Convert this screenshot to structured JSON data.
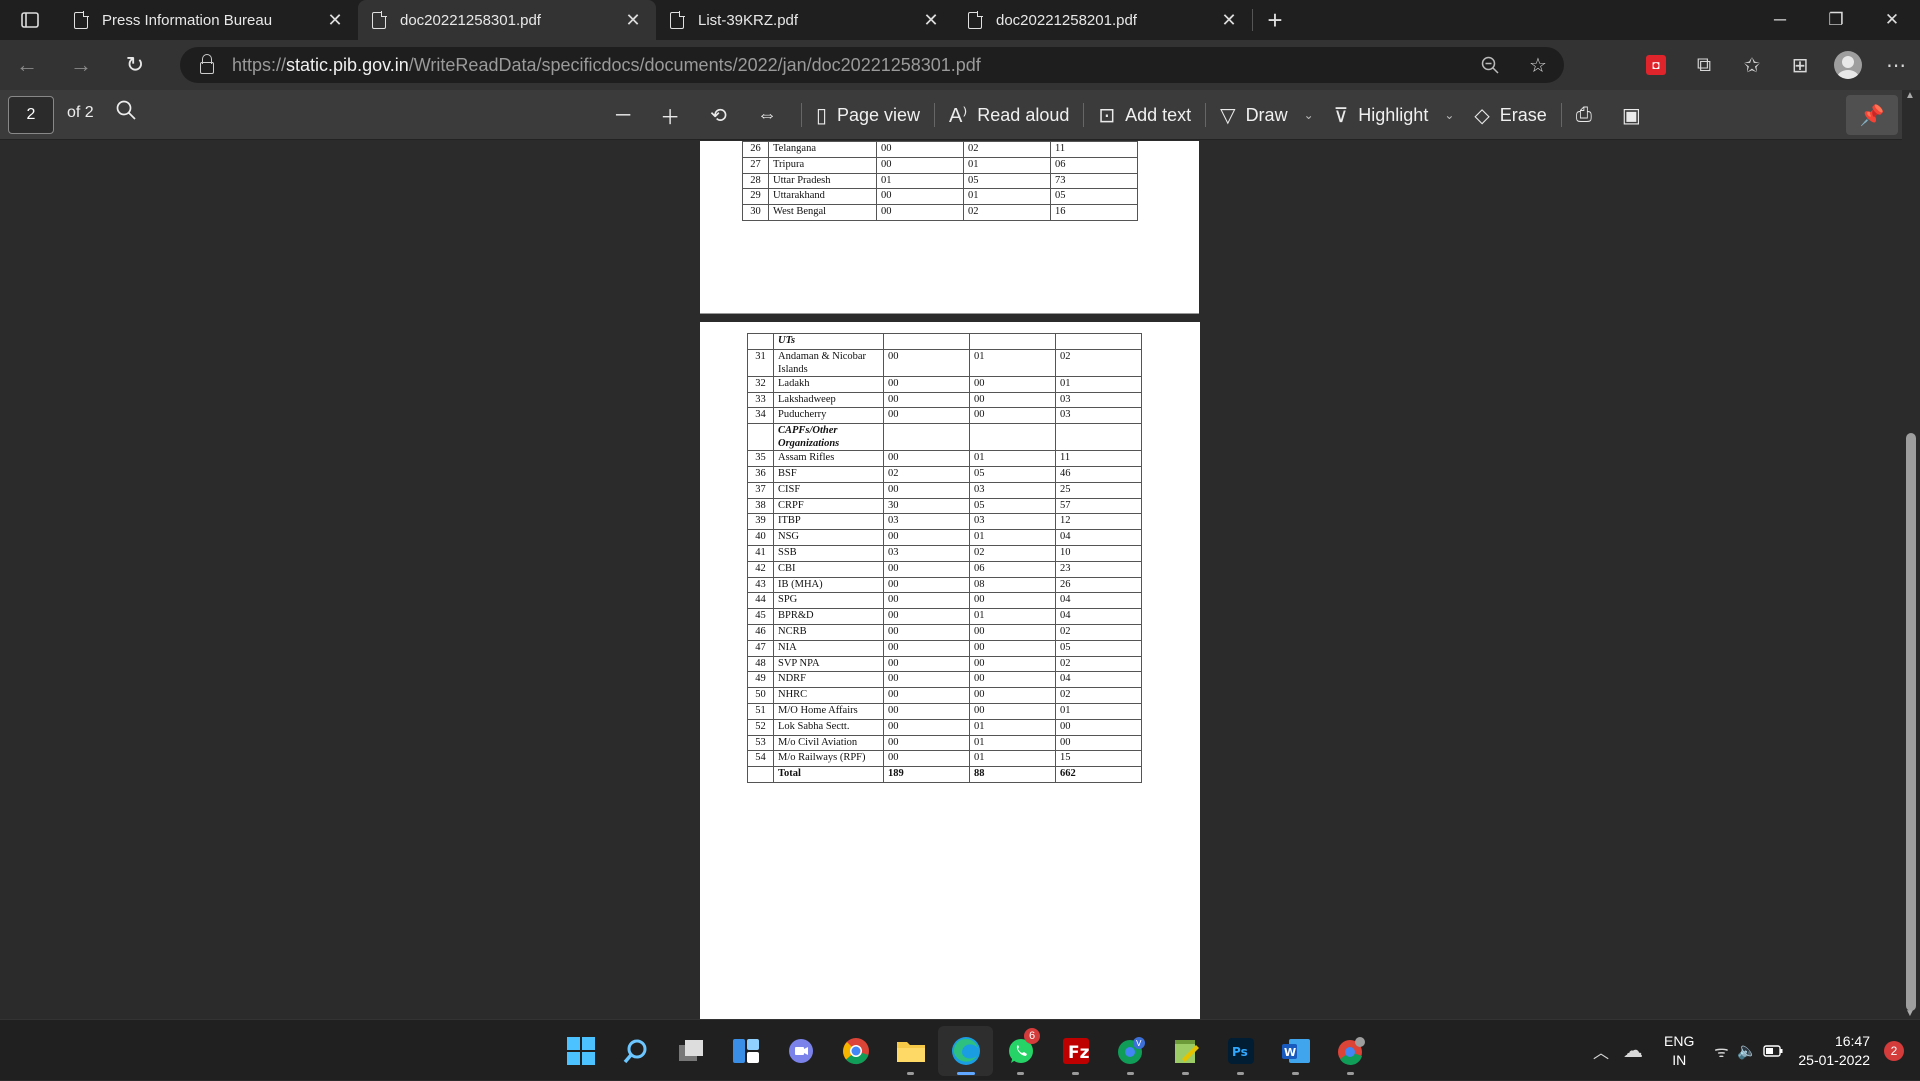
{
  "browser": {
    "tabs": [
      {
        "title": "Press Information Bureau",
        "active": false
      },
      {
        "title": "doc20221258301.pdf",
        "active": true
      },
      {
        "title": "List-39KRZ.pdf",
        "active": false
      },
      {
        "title": "doc20221258201.pdf",
        "active": false
      }
    ],
    "url_prefix": "https://",
    "url_host": "static.pib.gov.in",
    "url_path": "/WriteReadData/specificdocs/documents/2022/jan/doc20221258301.pdf"
  },
  "pdf_toolbar": {
    "current_page": "2",
    "page_count": "of 2",
    "page_view": "Page view",
    "read_aloud": "Read aloud",
    "add_text": "Add text",
    "draw": "Draw",
    "highlight": "Highlight",
    "erase": "Erase"
  },
  "page1_rows": [
    {
      "n": "26",
      "name": "Telangana",
      "a": "00",
      "b": "02",
      "c": "11"
    },
    {
      "n": "27",
      "name": "Tripura",
      "a": "00",
      "b": "01",
      "c": "06"
    },
    {
      "n": "28",
      "name": "Uttar Pradesh",
      "a": "01",
      "b": "05",
      "c": "73"
    },
    {
      "n": "29",
      "name": "Uttarakhand",
      "a": "00",
      "b": "01",
      "c": "05"
    },
    {
      "n": "30",
      "name": "West Bengal",
      "a": "00",
      "b": "02",
      "c": "16"
    }
  ],
  "page2_rows": [
    {
      "n": "",
      "name": "UTs",
      "a": "",
      "b": "",
      "c": "",
      "header": true
    },
    {
      "n": "31",
      "name": "Andaman & Nicobar",
      "name2": "Islands",
      "a": "00",
      "b": "01",
      "c": "02"
    },
    {
      "n": "32",
      "name": "Ladakh",
      "a": "00",
      "b": "00",
      "c": "01"
    },
    {
      "n": "33",
      "name": "Lakshadweep",
      "a": "00",
      "b": "00",
      "c": "03"
    },
    {
      "n": "34",
      "name": "Puducherry",
      "a": "00",
      "b": "00",
      "c": "03"
    },
    {
      "n": "",
      "name": "CAPFs/Other",
      "name2": "Organizations",
      "a": "",
      "b": "",
      "c": "",
      "header": true
    },
    {
      "n": "35",
      "name": "Assam Rifles",
      "a": "00",
      "b": "01",
      "c": "11"
    },
    {
      "n": "36",
      "name": "BSF",
      "a": "02",
      "b": "05",
      "c": "46"
    },
    {
      "n": "37",
      "name": "CISF",
      "a": "00",
      "b": "03",
      "c": "25"
    },
    {
      "n": "38",
      "name": "CRPF",
      "a": "30",
      "b": "05",
      "c": "57"
    },
    {
      "n": "39",
      "name": "ITBP",
      "a": "03",
      "b": "03",
      "c": "12"
    },
    {
      "n": "40",
      "name": "NSG",
      "a": "00",
      "b": "01",
      "c": "04"
    },
    {
      "n": "41",
      "name": "SSB",
      "a": "03",
      "b": "02",
      "c": "10"
    },
    {
      "n": "42",
      "name": "CBI",
      "a": "00",
      "b": "06",
      "c": "23"
    },
    {
      "n": "43",
      "name": "IB (MHA)",
      "a": "00",
      "b": "08",
      "c": "26"
    },
    {
      "n": "44",
      "name": "SPG",
      "a": "00",
      "b": "00",
      "c": "04"
    },
    {
      "n": "45",
      "name": "BPR&D",
      "a": "00",
      "b": "01",
      "c": "04"
    },
    {
      "n": "46",
      "name": "NCRB",
      "a": "00",
      "b": "00",
      "c": "02"
    },
    {
      "n": "47",
      "name": "NIA",
      "a": "00",
      "b": "00",
      "c": "05"
    },
    {
      "n": "48",
      "name": "SVP NPA",
      "a": "00",
      "b": "00",
      "c": "02"
    },
    {
      "n": "49",
      "name": "NDRF",
      "a": "00",
      "b": "00",
      "c": "04"
    },
    {
      "n": "50",
      "name": "NHRC",
      "a": "00",
      "b": "00",
      "c": "02"
    },
    {
      "n": "51",
      "name": "M/O Home Affairs",
      "a": "00",
      "b": "00",
      "c": "01"
    },
    {
      "n": "52",
      "name": "Lok Sabha Sectt.",
      "a": "00",
      "b": "01",
      "c": "00"
    },
    {
      "n": "53",
      "name": "M/o Civil Aviation",
      "a": "00",
      "b": "01",
      "c": "00"
    },
    {
      "n": "54",
      "name": "M/o Railways (RPF)",
      "a": "00",
      "b": "01",
      "c": "15"
    },
    {
      "n": "",
      "name": "Total",
      "a": "189",
      "b": "88",
      "c": "662",
      "total": true
    }
  ],
  "taskbar": {
    "apps": [
      "start",
      "search",
      "task-view",
      "widgets",
      "teams-chat",
      "chrome",
      "file-explorer",
      "edge",
      "whatsapp",
      "filezilla",
      "chrome-profile",
      "notepad-plus",
      "photoshop",
      "word",
      "chrome-dev"
    ],
    "whatsapp_badge": "6",
    "lang_line1": "ENG",
    "lang_line2": "IN",
    "time": "16:47",
    "date": "25-01-2022",
    "notifications": "2"
  }
}
